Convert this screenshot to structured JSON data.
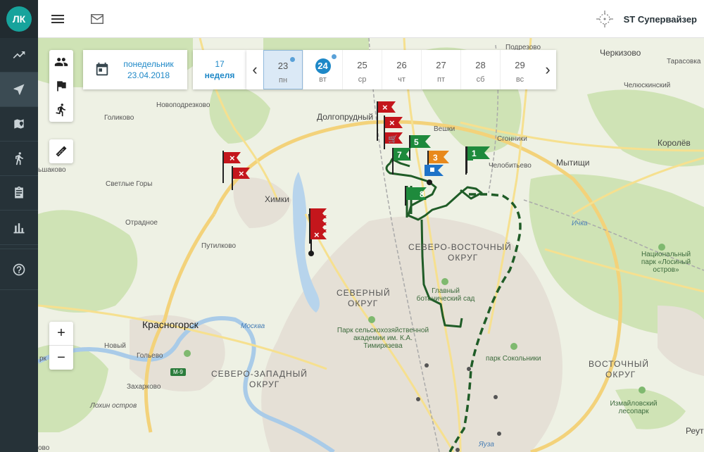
{
  "sidebar": {
    "avatar": "ЛК",
    "items": [
      {
        "name": "analytics",
        "icon": "trending-up-icon"
      },
      {
        "name": "navigation",
        "icon": "navigation-icon",
        "active": true
      },
      {
        "name": "map",
        "icon": "map-pin-icon"
      },
      {
        "name": "activity",
        "icon": "walk-icon"
      },
      {
        "name": "tasks",
        "icon": "clipboard-icon"
      },
      {
        "name": "reports",
        "icon": "bar-chart-icon"
      },
      {
        "name": "help",
        "icon": "help-icon"
      }
    ]
  },
  "topbar": {
    "menu_icon": "menu-icon",
    "mail_icon": "mail-icon",
    "user_icon": "crosshair-icon",
    "user_name": "ST Супервайзер"
  },
  "date_panel": {
    "weekday": "понедельник",
    "date": "23.04.2018",
    "week_number": "17",
    "week_label": "неделя",
    "days": [
      {
        "num": "23",
        "wd": "пн",
        "selected": true,
        "dot": true
      },
      {
        "num": "24",
        "wd": "вт",
        "today": true,
        "dot": true
      },
      {
        "num": "25",
        "wd": "ср"
      },
      {
        "num": "26",
        "wd": "чт"
      },
      {
        "num": "27",
        "wd": "пт"
      },
      {
        "num": "28",
        "wd": "сб"
      },
      {
        "num": "29",
        "wd": "вс"
      }
    ]
  },
  "map_controls": {
    "zoom_in": "+",
    "zoom_out": "−"
  },
  "map_labels": {
    "podrezovo": "Подрезово",
    "cherkizovo": "Черкизово",
    "tarasovka": "Тарасовка",
    "chelyuskinsky": "Челюскинский",
    "novopodrezkovo": "Новоподрезково",
    "dolgoprudny": "Долгопрудный",
    "golikovo": "Голиково",
    "veshki": "Вешки",
    "sgonniki": "Сгонники",
    "korolev": "Королёв",
    "chelobitevo": "Челобитьево",
    "mytishchi": "Мытищи",
    "sheremetyevo": "ьшаково",
    "svetlye_gory": "Светлые Горы",
    "khimki": "Химки",
    "otradnoe": "Отрадное",
    "putilkovo": "Путилково",
    "severo_vostochny_1": "СЕВЕРО-ВОСТОЧНЫЙ",
    "severo_vostochny_2": "ОКРУГ",
    "national_park": "Национальный парк «Лосиный остров»",
    "severny_1": "СЕВЕРНЫЙ",
    "severny_2": "ОКРУГ",
    "botanical_garden": "Главный ботанический сад",
    "timiryazev_park": "Парк сельскохозяйственной академии им. К.А. Тимирязева",
    "krasnogorsk": "Красногорск",
    "novy": "Новый",
    "golyevo": "Гольево",
    "rk": "рк",
    "zakharkovo": "Захарково",
    "m9": "М-9",
    "severo_zapadny_1": "СЕВЕРО-ЗАПАДНЫЙ",
    "severo_zapadny_2": "ОКРУГ",
    "sokolniki_park": "парк Сокольники",
    "vostochny_1": "ВОСТОЧНЫЙ",
    "vostochny_2": "ОКРУГ",
    "izmailovsky_park": "Измайловский лесопарк",
    "lokhin_ostrov": "Лохин остров",
    "reutov": "Реут",
    "moskva_river": "Москва",
    "yauza": "Яуза",
    "ichka": "Ичка",
    "tushino_left": "ово"
  },
  "flags": [
    {
      "label": "1",
      "color": "#1e8a3c"
    },
    {
      "label": "3",
      "color": "#e8891c"
    },
    {
      "label": "5",
      "color": "#1e8a3c"
    },
    {
      "label": "7",
      "color": "#1e8a3c"
    },
    {
      "label": "8",
      "color": "#1e8a3c"
    }
  ]
}
